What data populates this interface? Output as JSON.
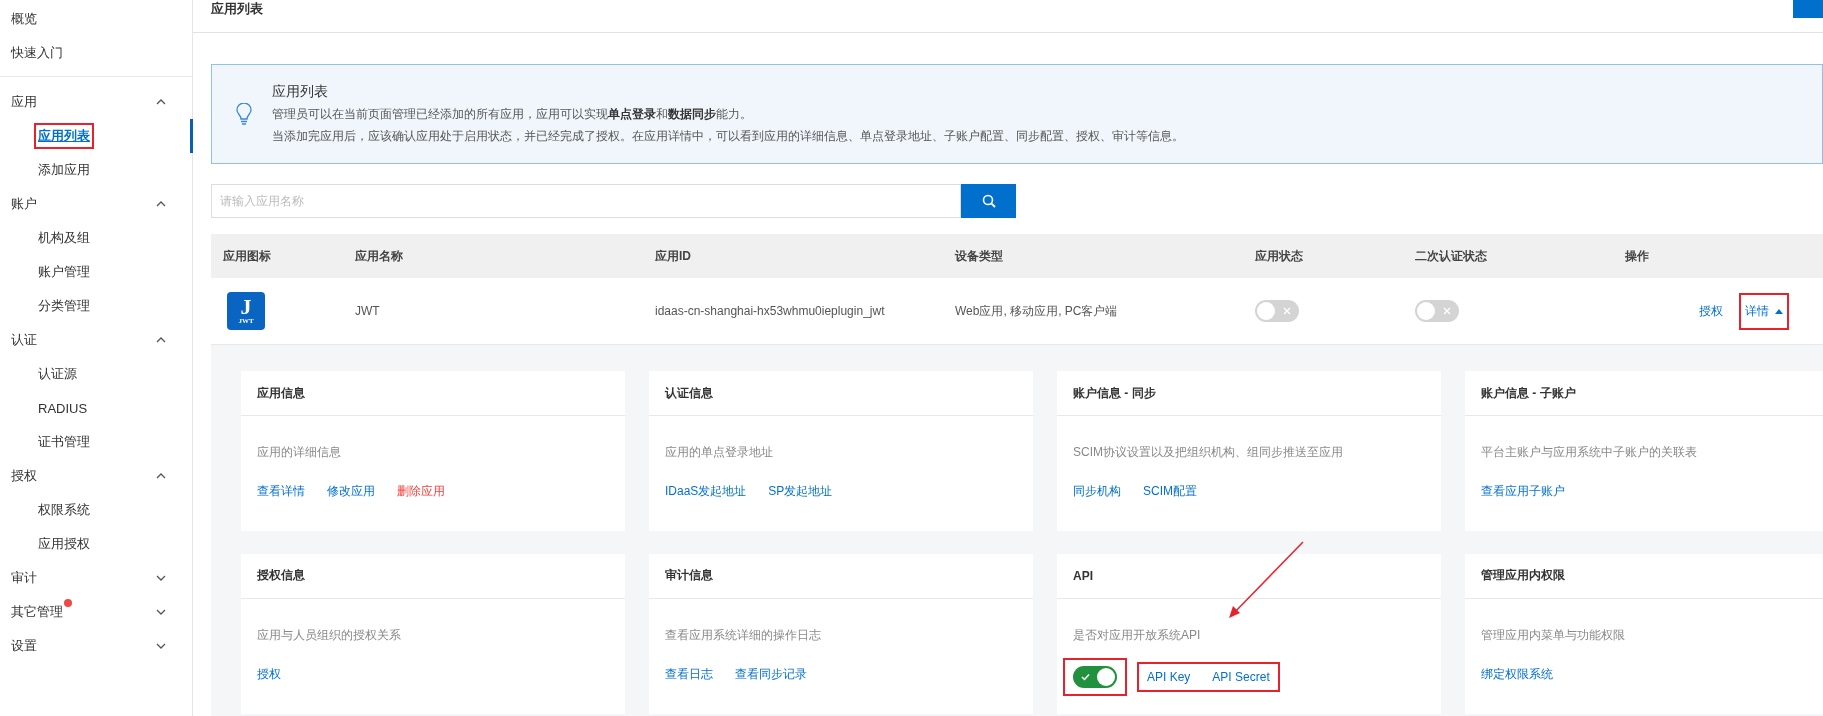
{
  "sidebar": {
    "top_items": [
      {
        "label": "概览"
      },
      {
        "label": "快速入门"
      }
    ],
    "groups": [
      {
        "label": "应用",
        "expanded": true,
        "badge": false,
        "children": [
          {
            "label": "应用列表",
            "selected": true,
            "highlighted": true
          },
          {
            "label": "添加应用",
            "selected": false,
            "highlighted": false
          }
        ]
      },
      {
        "label": "账户",
        "expanded": true,
        "badge": false,
        "children": [
          {
            "label": "机构及组",
            "selected": false,
            "highlighted": false
          },
          {
            "label": "账户管理",
            "selected": false,
            "highlighted": false
          },
          {
            "label": "分类管理",
            "selected": false,
            "highlighted": false
          }
        ]
      },
      {
        "label": "认证",
        "expanded": true,
        "badge": false,
        "children": [
          {
            "label": "认证源",
            "selected": false,
            "highlighted": false
          },
          {
            "label": "RADIUS",
            "selected": false,
            "highlighted": false
          },
          {
            "label": "证书管理",
            "selected": false,
            "highlighted": false
          }
        ]
      },
      {
        "label": "授权",
        "expanded": true,
        "badge": false,
        "children": [
          {
            "label": "权限系统",
            "selected": false,
            "highlighted": false
          },
          {
            "label": "应用授权",
            "selected": false,
            "highlighted": false
          }
        ]
      },
      {
        "label": "审计",
        "expanded": false,
        "badge": false
      },
      {
        "label": "其它管理",
        "expanded": false,
        "badge": true
      },
      {
        "label": "设置",
        "expanded": false,
        "badge": false
      }
    ]
  },
  "header": {
    "title": "应用列表"
  },
  "notice": {
    "title": "应用列表",
    "lines": [
      "管理员可以在当前页面管理已经添加的所有应用，应用可以实现**单点登录**和**数据同步**能力。",
      "当添加完应用后，应该确认应用处于启用状态，并已经完成了授权。在应用详情中，可以看到应用的详细信息、单点登录地址、子账户配置、同步配置、授权、审计等信息。"
    ]
  },
  "search": {
    "placeholder": "请输入应用名称"
  },
  "table": {
    "columns": [
      "应用图标",
      "应用名称",
      "应用ID",
      "设备类型",
      "应用状态",
      "二次认证状态",
      "操作"
    ],
    "rows": [
      {
        "icon_letter": "J",
        "icon_caption": "JWT",
        "name": "JWT",
        "app_id": "idaas-cn-shanghai-hx53whmu0ieplugin_jwt",
        "device_types": "Web应用, 移动应用, PC客户端",
        "enabled": false,
        "mfa_enabled": false,
        "actions": [
          {
            "label": "授权",
            "highlighted": false,
            "kind": "link"
          },
          {
            "label": "详情",
            "highlighted": true,
            "expanded": true,
            "kind": "toggle"
          }
        ],
        "cards": [
          {
            "title": "应用信息",
            "description": "应用的详细信息",
            "arrow": false,
            "groups": [
              {
                "kind": "links",
                "highlighted": false,
                "links": [
                  {
                    "label": "查看详情",
                    "danger": false
                  },
                  {
                    "label": "修改应用",
                    "danger": false
                  },
                  {
                    "label": "删除应用",
                    "danger": true
                  }
                ]
              }
            ]
          },
          {
            "title": "认证信息",
            "description": "应用的单点登录地址",
            "arrow": false,
            "groups": [
              {
                "kind": "links",
                "highlighted": false,
                "links": [
                  {
                    "label": "IDaaS发起地址",
                    "danger": false
                  },
                  {
                    "label": "SP发起地址",
                    "danger": false
                  }
                ]
              }
            ]
          },
          {
            "title": "账户信息 - 同步",
            "description": "SCIM协议设置以及把组织机构、组同步推送至应用",
            "arrow": false,
            "groups": [
              {
                "kind": "links",
                "highlighted": false,
                "links": [
                  {
                    "label": "同步机构",
                    "danger": false
                  },
                  {
                    "label": "SCIM配置",
                    "danger": false
                  }
                ]
              }
            ]
          },
          {
            "title": "账户信息 - 子账户",
            "description": "平台主账户与应用系统中子账户的关联表",
            "arrow": false,
            "groups": [
              {
                "kind": "links",
                "highlighted": false,
                "links": [
                  {
                    "label": "查看应用子账户",
                    "danger": false
                  }
                ]
              }
            ]
          },
          {
            "title": "授权信息",
            "description": "应用与人员组织的授权关系",
            "arrow": false,
            "groups": [
              {
                "kind": "links",
                "highlighted": false,
                "links": [
                  {
                    "label": "授权",
                    "danger": false
                  }
                ]
              }
            ]
          },
          {
            "title": "审计信息",
            "description": "查看应用系统详细的操作日志",
            "arrow": false,
            "groups": [
              {
                "kind": "links",
                "highlighted": false,
                "links": [
                  {
                    "label": "查看日志",
                    "danger": false
                  },
                  {
                    "label": "查看同步记录",
                    "danger": false
                  }
                ]
              }
            ]
          },
          {
            "title": "API",
            "description": "是否对应用开放系统API",
            "arrow": true,
            "groups": [
              {
                "kind": "toggle",
                "highlighted": true,
                "on": true
              },
              {
                "kind": "links",
                "highlighted": true,
                "links": [
                  {
                    "label": "API Key",
                    "danger": false
                  },
                  {
                    "label": "API Secret",
                    "danger": false
                  }
                ]
              }
            ]
          },
          {
            "title": "管理应用内权限",
            "description": "管理应用内菜单与功能权限",
            "arrow": false,
            "groups": [
              {
                "kind": "links",
                "highlighted": false,
                "links": [
                  {
                    "label": "绑定权限系统",
                    "danger": false
                  }
                ]
              }
            ]
          }
        ]
      }
    ]
  }
}
